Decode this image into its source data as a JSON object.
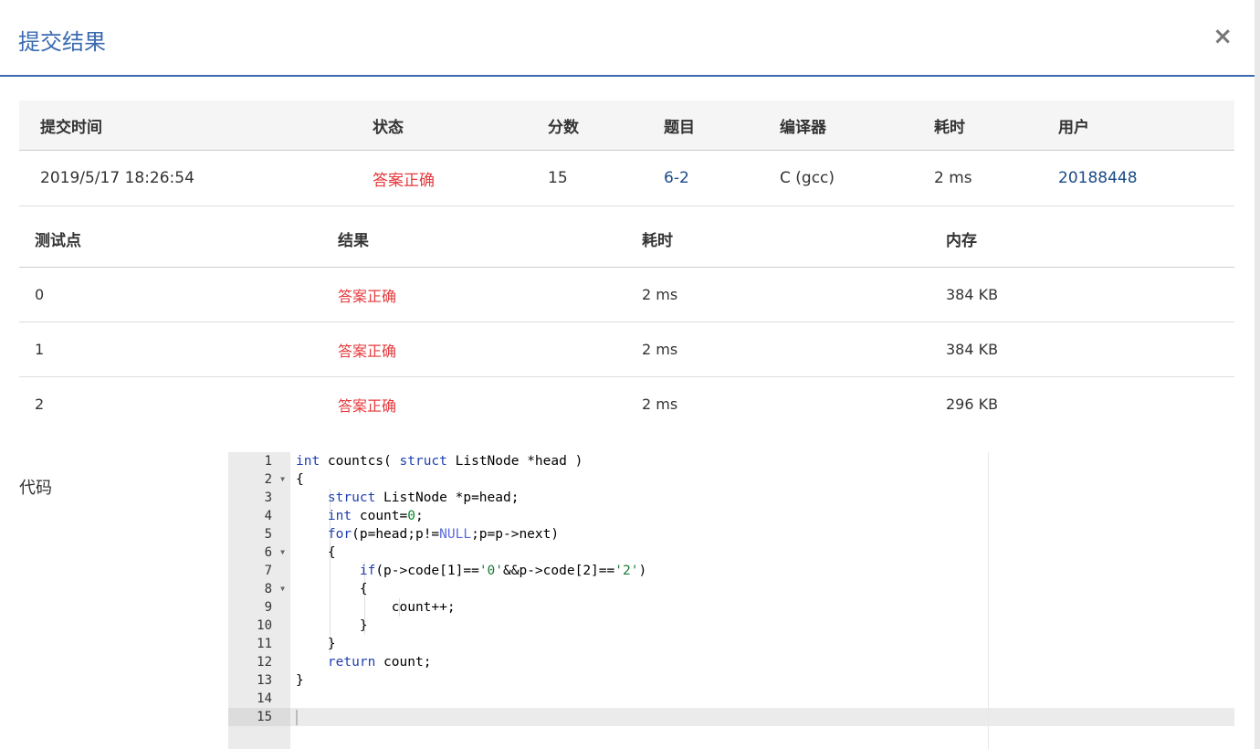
{
  "dialog": {
    "title": "提交结果",
    "close_label": "×"
  },
  "summary": {
    "headers": [
      "提交时间",
      "状态",
      "分数",
      "题目",
      "编译器",
      "耗时",
      "用户"
    ],
    "row": {
      "time": "2019/5/17 18:26:54",
      "status": "答案正确",
      "score": "15",
      "problem": "6-2",
      "compiler": "C (gcc)",
      "duration": "2 ms",
      "user": "20188448"
    }
  },
  "tests": {
    "headers": [
      "测试点",
      "结果",
      "耗时",
      "内存"
    ],
    "rows": [
      {
        "id": "0",
        "result": "答案正确",
        "time": "2 ms",
        "memory": "384 KB"
      },
      {
        "id": "1",
        "result": "答案正确",
        "time": "2 ms",
        "memory": "384 KB"
      },
      {
        "id": "2",
        "result": "答案正确",
        "time": "2 ms",
        "memory": "296 KB"
      }
    ]
  },
  "code": {
    "label": "代码",
    "lines": [
      "int countcs( struct ListNode *head )",
      "{",
      "    struct ListNode *p=head;",
      "    int count=0;",
      "    for(p=head;p!=NULL;p=p->next)",
      "    {",
      "        if(p->code[1]=='0'&&p->code[2]=='2')",
      "        {",
      "            count++;",
      "        }",
      "    }",
      "    return count;",
      "}",
      "",
      ""
    ],
    "line_numbers": [
      "1",
      "2",
      "3",
      "4",
      "5",
      "6",
      "7",
      "8",
      "9",
      "10",
      "11",
      "12",
      "13",
      "14",
      "15"
    ],
    "fold_marker": "▼"
  },
  "colors": {
    "accent": "#3a6ab0",
    "success": "#e4393c",
    "link": "#1a4b86"
  }
}
